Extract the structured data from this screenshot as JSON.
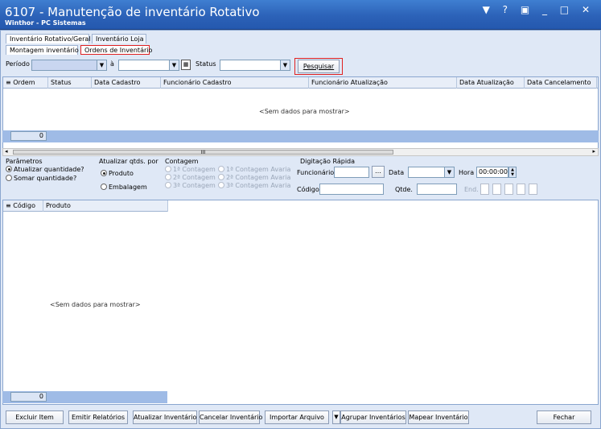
{
  "window": {
    "title": "6107 - Manutenção de inventário Rotativo",
    "subtitle": "Winthor - PC Sistemas",
    "controls": "▼ ? ▣ _ □ ✕"
  },
  "tabs_top": [
    {
      "label": "Inventário Rotativo/Geral"
    },
    {
      "label": "Inventário Loja"
    }
  ],
  "tabs_sub": [
    {
      "label": "Montagem inventário"
    },
    {
      "label": "Ordens de Inventário"
    }
  ],
  "filter": {
    "periodo_label": "Período",
    "a_label": "à",
    "status_label": "Status",
    "search_button": "Pesquisar"
  },
  "orders_grid": {
    "columns": [
      "Ordem",
      "Status",
      "Data Cadastro",
      "Funcionário Cadastro",
      "Funcionário Atualização",
      "Data Atualização",
      "Data Cancelamento"
    ],
    "empty_text": "<Sem dados para mostrar>",
    "footer_count": "0"
  },
  "params": {
    "title": "Parâmetros",
    "option1": "Atualizar quantidade?",
    "option2": "Somar quantidade?"
  },
  "update_by": {
    "title": "Atualizar qtds. por",
    "option1": "Produto",
    "option2": "Embalagem"
  },
  "contagem": {
    "title": "Contagem",
    "c1": "1ª Contagem",
    "c2": "2ª Contagem",
    "c3": "3ª Contagem",
    "a1": "1ª Contagem Avaria",
    "a2": "2ª Contagem Avaria",
    "a3": "3ª Contagem Avaria"
  },
  "quick_entry": {
    "title": "Digitação Rápida",
    "funcionario_label": "Funcionário",
    "data_label": "Data",
    "hora_label": "Hora",
    "hora_value": "00:00:00",
    "codigo_label": "Código",
    "qtde_label": "Qtde.",
    "end_label": "End."
  },
  "products_grid": {
    "columns": [
      "Código",
      "Produto"
    ],
    "empty_text": "<Sem dados para mostrar>",
    "footer_count": "0"
  },
  "bottom_buttons": {
    "excluir": "Excluir Item",
    "emitir": "Emitir Relatórios",
    "atualizar": "Atualizar Inventário",
    "cancelar": "Cancelar Inventário",
    "importar": "Importar Arquivo",
    "agrupar": "Agrupar Inventários",
    "mapear": "Mapear Inventário",
    "fechar": "Fechar"
  },
  "colors": {
    "title_bar": "#2c62b8",
    "highlight": "#e02020",
    "footer": "#9fbbe6"
  }
}
